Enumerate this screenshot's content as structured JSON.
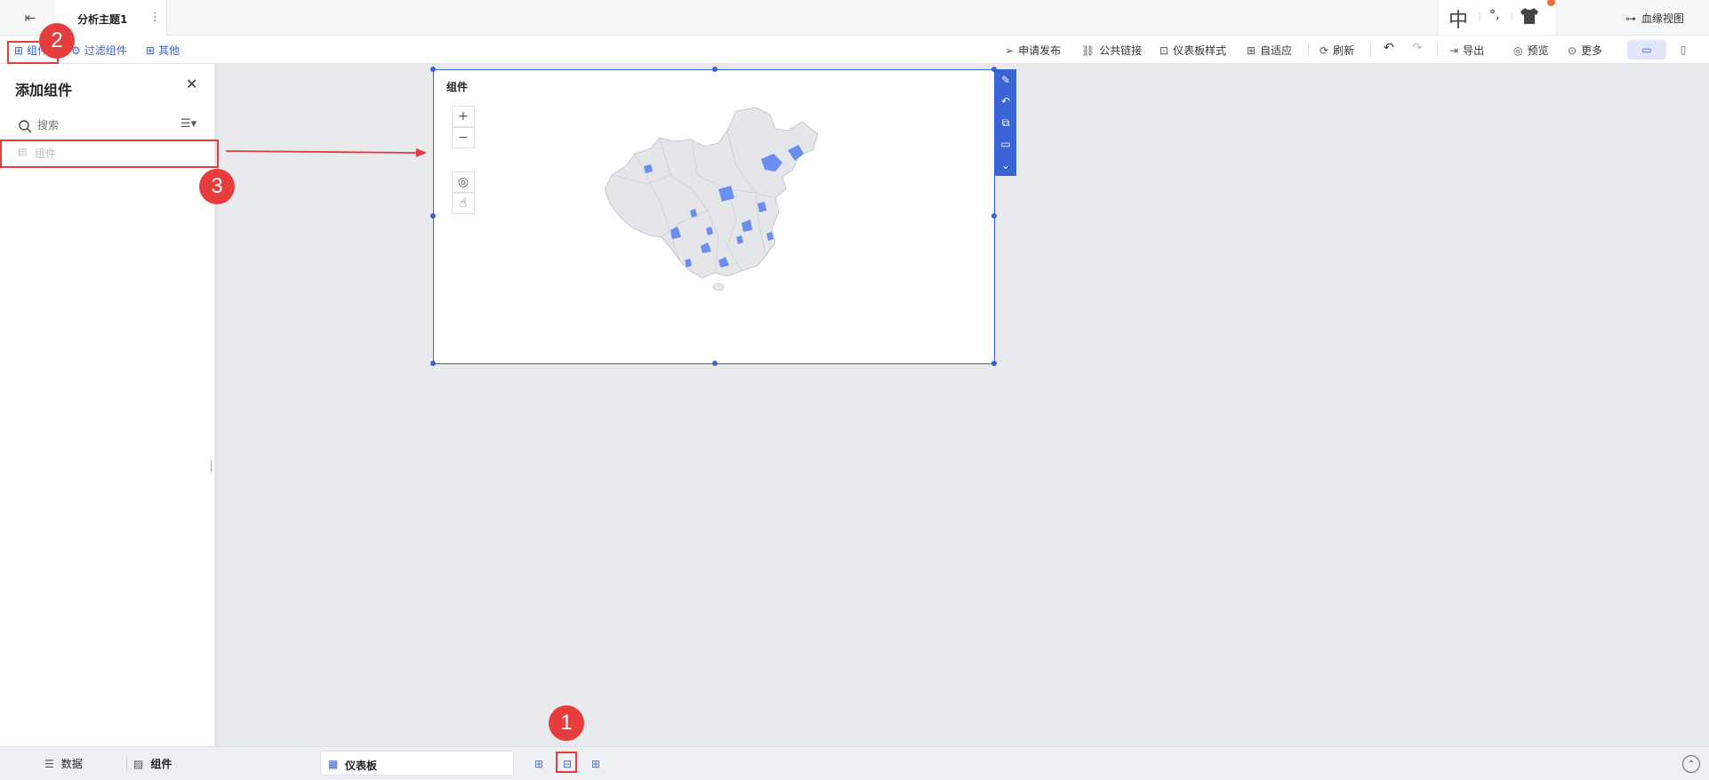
{
  "header": {
    "tab_title": "分析主题1",
    "more_symbol": "⋮",
    "ime": {
      "zh_label": "中",
      "mark_label": "°,",
      "sep": "⁞"
    },
    "lineage_label": "血缘视图"
  },
  "toolbar": {
    "left": {
      "component_label": "组件",
      "filter_label": "过滤组件",
      "other_label": "其他"
    },
    "right": {
      "publish_label": "申请发布",
      "public_link_label": "公共链接",
      "dashboard_style_label": "仪表板样式",
      "adaptive_label": "自适应",
      "refresh_label": "刷新",
      "export_label": "导出",
      "preview_label": "预览",
      "more_label": "更多"
    }
  },
  "panel": {
    "title": "添加组件",
    "search_placeholder": "搜索",
    "items": [
      {
        "label": "组件"
      }
    ]
  },
  "widget": {
    "title": "组件",
    "zoom_in": "+",
    "zoom_out": "−",
    "accent": "#3a63d6",
    "map_fill": "#e4e6ea",
    "map_highlight": "#6a8ef0"
  },
  "bottombar": {
    "data_tab": "数据",
    "component_tab": "组件",
    "dashboard_tab": "仪表板"
  },
  "annotations": {
    "n1": "1",
    "n2": "2",
    "n3": "3"
  }
}
